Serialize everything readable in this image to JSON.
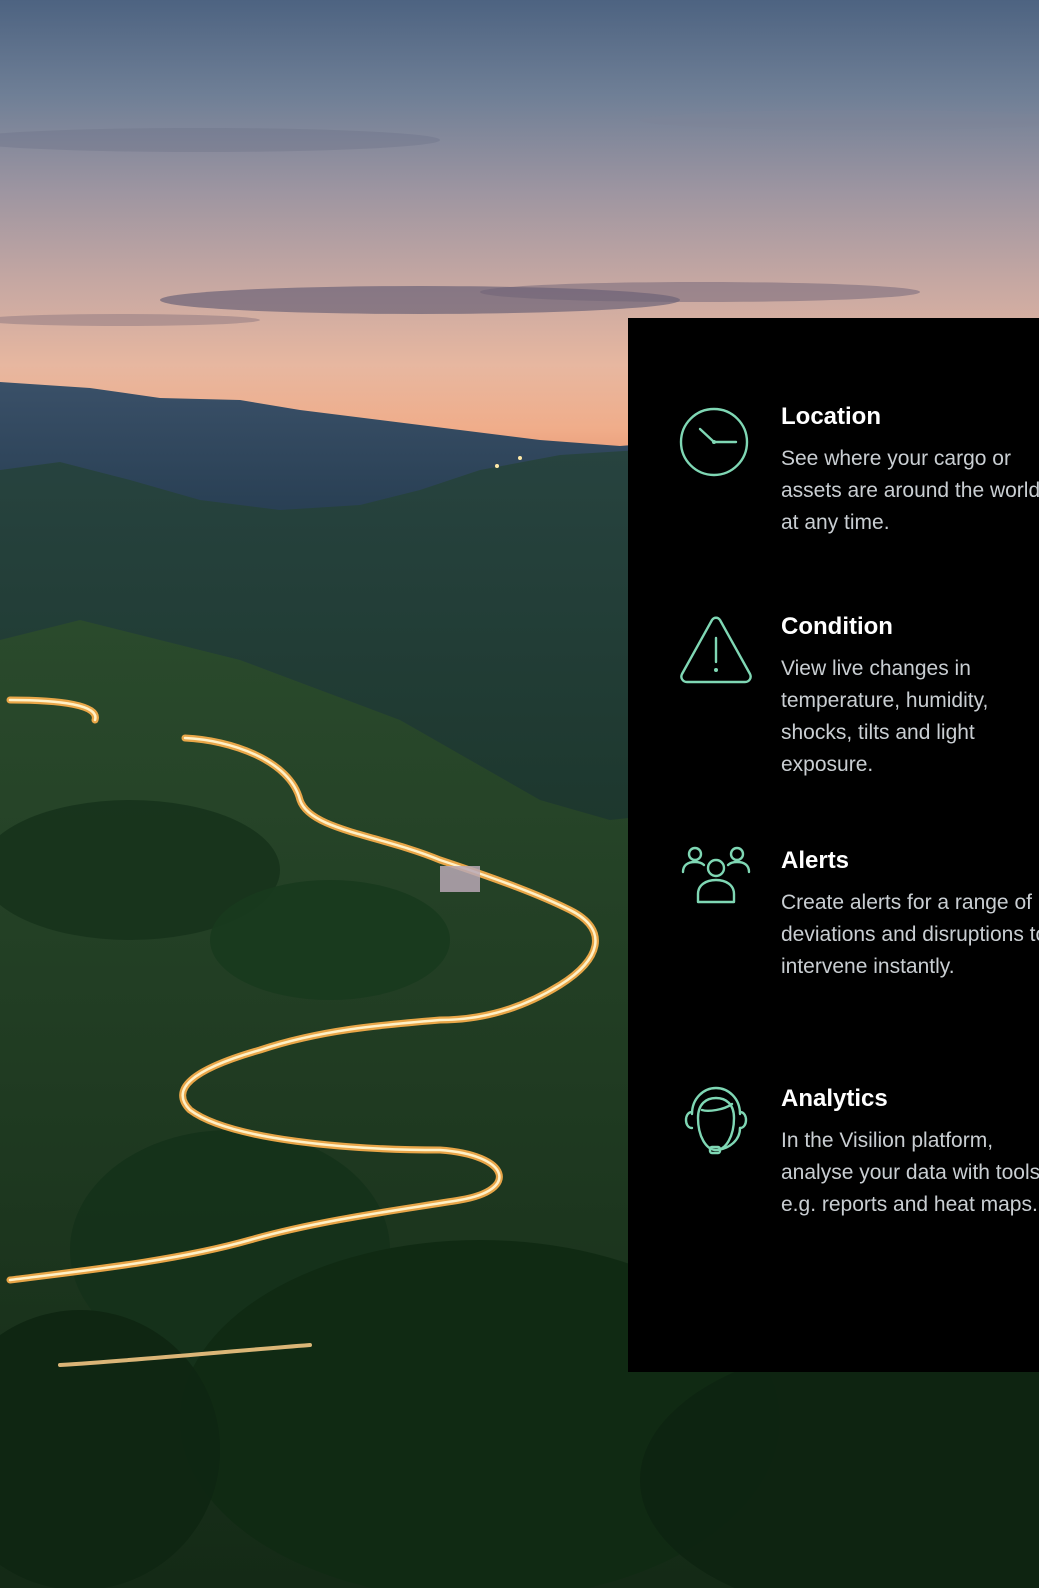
{
  "features": [
    {
      "title": "Location",
      "description": "See where your cargo or assets are around the world, at any time.",
      "icon": "clock-icon"
    },
    {
      "title": "Condition",
      "description": "View live changes in temperature, humidity, shocks, tilts and light exposure.",
      "icon": "warning-triangle-icon"
    },
    {
      "title": "Alerts",
      "description": "Create alerts for a range of deviations and disruptions to intervene instantly.",
      "icon": "people-group-icon"
    },
    {
      "title": "Analytics",
      "description": "In the Visilion platform, analyse your data with tools, e.g. reports and heat maps.",
      "icon": "headset-agent-icon"
    }
  ],
  "colors": {
    "panel_background": "#000000",
    "icon_accent": "#7fd7b4",
    "title_text": "#ffffff",
    "description_text": "#c9ced2"
  }
}
